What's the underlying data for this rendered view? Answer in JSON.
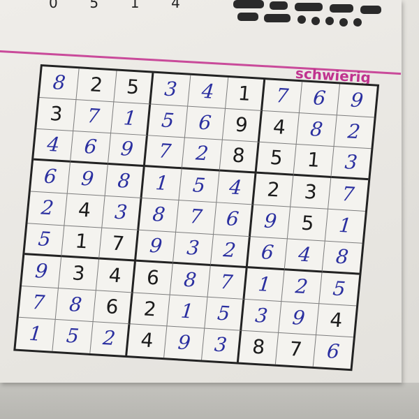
{
  "header": {
    "top_numbers": [
      "0",
      "5",
      "1",
      "4"
    ],
    "difficulty_label": "schwierig"
  },
  "colors": {
    "accent": "#c0338f",
    "ink_handwritten": "#2a2fa0",
    "ink_printed": "#1b1b1b"
  },
  "sudoku": {
    "rows": [
      [
        {
          "v": "8",
          "t": "hand"
        },
        {
          "v": "2",
          "t": "print"
        },
        {
          "v": "5",
          "t": "print"
        },
        {
          "v": "3",
          "t": "hand"
        },
        {
          "v": "4",
          "t": "hand"
        },
        {
          "v": "1",
          "t": "print"
        },
        {
          "v": "7",
          "t": "hand"
        },
        {
          "v": "6",
          "t": "hand"
        },
        {
          "v": "9",
          "t": "hand"
        }
      ],
      [
        {
          "v": "3",
          "t": "print"
        },
        {
          "v": "7",
          "t": "hand"
        },
        {
          "v": "1",
          "t": "hand"
        },
        {
          "v": "5",
          "t": "hand"
        },
        {
          "v": "6",
          "t": "hand"
        },
        {
          "v": "9",
          "t": "print"
        },
        {
          "v": "4",
          "t": "print"
        },
        {
          "v": "8",
          "t": "hand"
        },
        {
          "v": "2",
          "t": "hand"
        }
      ],
      [
        {
          "v": "4",
          "t": "hand"
        },
        {
          "v": "6",
          "t": "hand"
        },
        {
          "v": "9",
          "t": "hand"
        },
        {
          "v": "7",
          "t": "hand"
        },
        {
          "v": "2",
          "t": "hand"
        },
        {
          "v": "8",
          "t": "print"
        },
        {
          "v": "5",
          "t": "print"
        },
        {
          "v": "1",
          "t": "print"
        },
        {
          "v": "3",
          "t": "hand"
        }
      ],
      [
        {
          "v": "6",
          "t": "hand"
        },
        {
          "v": "9",
          "t": "hand"
        },
        {
          "v": "8",
          "t": "hand"
        },
        {
          "v": "1",
          "t": "hand"
        },
        {
          "v": "5",
          "t": "hand"
        },
        {
          "v": "4",
          "t": "hand"
        },
        {
          "v": "2",
          "t": "print"
        },
        {
          "v": "3",
          "t": "print"
        },
        {
          "v": "7",
          "t": "hand"
        }
      ],
      [
        {
          "v": "2",
          "t": "hand"
        },
        {
          "v": "4",
          "t": "print"
        },
        {
          "v": "3",
          "t": "hand"
        },
        {
          "v": "8",
          "t": "hand"
        },
        {
          "v": "7",
          "t": "hand"
        },
        {
          "v": "6",
          "t": "hand"
        },
        {
          "v": "9",
          "t": "hand"
        },
        {
          "v": "5",
          "t": "print"
        },
        {
          "v": "1",
          "t": "hand"
        }
      ],
      [
        {
          "v": "5",
          "t": "hand"
        },
        {
          "v": "1",
          "t": "print"
        },
        {
          "v": "7",
          "t": "print"
        },
        {
          "v": "9",
          "t": "hand"
        },
        {
          "v": "3",
          "t": "hand"
        },
        {
          "v": "2",
          "t": "hand"
        },
        {
          "v": "6",
          "t": "hand"
        },
        {
          "v": "4",
          "t": "hand"
        },
        {
          "v": "8",
          "t": "hand"
        }
      ],
      [
        {
          "v": "9",
          "t": "hand"
        },
        {
          "v": "3",
          "t": "print"
        },
        {
          "v": "4",
          "t": "print"
        },
        {
          "v": "6",
          "t": "print"
        },
        {
          "v": "8",
          "t": "hand"
        },
        {
          "v": "7",
          "t": "hand"
        },
        {
          "v": "1",
          "t": "hand"
        },
        {
          "v": "2",
          "t": "hand"
        },
        {
          "v": "5",
          "t": "hand"
        }
      ],
      [
        {
          "v": "7",
          "t": "hand"
        },
        {
          "v": "8",
          "t": "hand"
        },
        {
          "v": "6",
          "t": "print"
        },
        {
          "v": "2",
          "t": "print"
        },
        {
          "v": "1",
          "t": "hand"
        },
        {
          "v": "5",
          "t": "hand"
        },
        {
          "v": "3",
          "t": "hand"
        },
        {
          "v": "9",
          "t": "hand"
        },
        {
          "v": "4",
          "t": "print"
        }
      ],
      [
        {
          "v": "1",
          "t": "hand"
        },
        {
          "v": "5",
          "t": "hand"
        },
        {
          "v": "2",
          "t": "hand"
        },
        {
          "v": "4",
          "t": "print"
        },
        {
          "v": "9",
          "t": "hand"
        },
        {
          "v": "3",
          "t": "hand"
        },
        {
          "v": "8",
          "t": "print"
        },
        {
          "v": "7",
          "t": "print"
        },
        {
          "v": "6",
          "t": "hand"
        }
      ]
    ]
  }
}
